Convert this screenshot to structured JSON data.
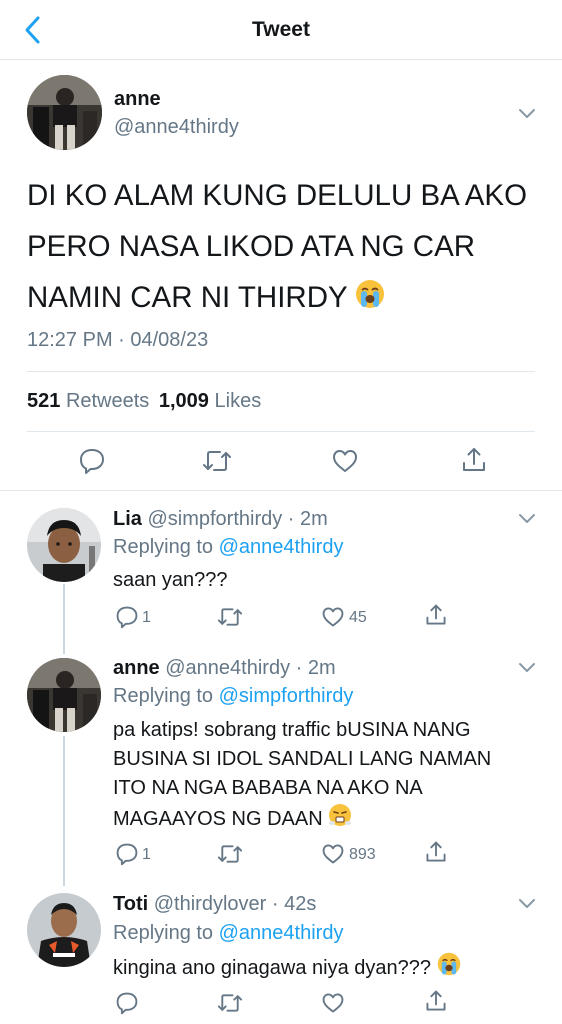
{
  "header": {
    "title": "Tweet",
    "back_icon": "chevron-left-icon",
    "accent_color": "#1da1f2"
  },
  "tweet": {
    "author_name": "anne",
    "author_handle": "@anne4thirdy",
    "text_lines": [
      "DI KO ALAM KUNG DELULU BA AKO",
      "PERO NASA LIKOD ATA NG CAR",
      "NAMIN CAR NI THIRDY"
    ],
    "text_emoji": "loudly-crying-face-emoji",
    "timestamp": "12:27 PM · 04/08/23",
    "retweets_count": "521",
    "retweets_label": "Retweets",
    "likes_count": "1,009",
    "likes_label": "Likes",
    "actions": [
      "reply-icon",
      "retweet-icon",
      "like-icon",
      "share-icon"
    ]
  },
  "replies": [
    {
      "name": "Lia",
      "handle": "@simpforthirdy · 2m",
      "replying_prefix": "Replying to",
      "replying_to": "@anne4thirdy",
      "text": "saan yan???",
      "reply_count": "1",
      "like_count": "45"
    },
    {
      "name": "anne",
      "handle": "@anne4thirdy · 2m",
      "replying_prefix": "Replying to",
      "replying_to": "@simpforthirdy",
      "text_lines": [
        "pa katips! sobrang traffic bUSINA NANG",
        "BUSINA SI IDOL SANDALI LANG NAMAN",
        "ITO NA NGA BABABA NA AKO NA",
        "MAGAAYOS NG DAAN"
      ],
      "text_emoji": "face-with-steam-emoji",
      "reply_count": "1",
      "like_count": "893"
    },
    {
      "name": "Toti",
      "handle": "@thirdylover · 42s",
      "replying_prefix": "Replying to",
      "replying_to": "@anne4thirdy",
      "text": "kingina ano ginagawa niya dyan???",
      "text_emoji": "loudly-crying-face-emoji"
    }
  ]
}
